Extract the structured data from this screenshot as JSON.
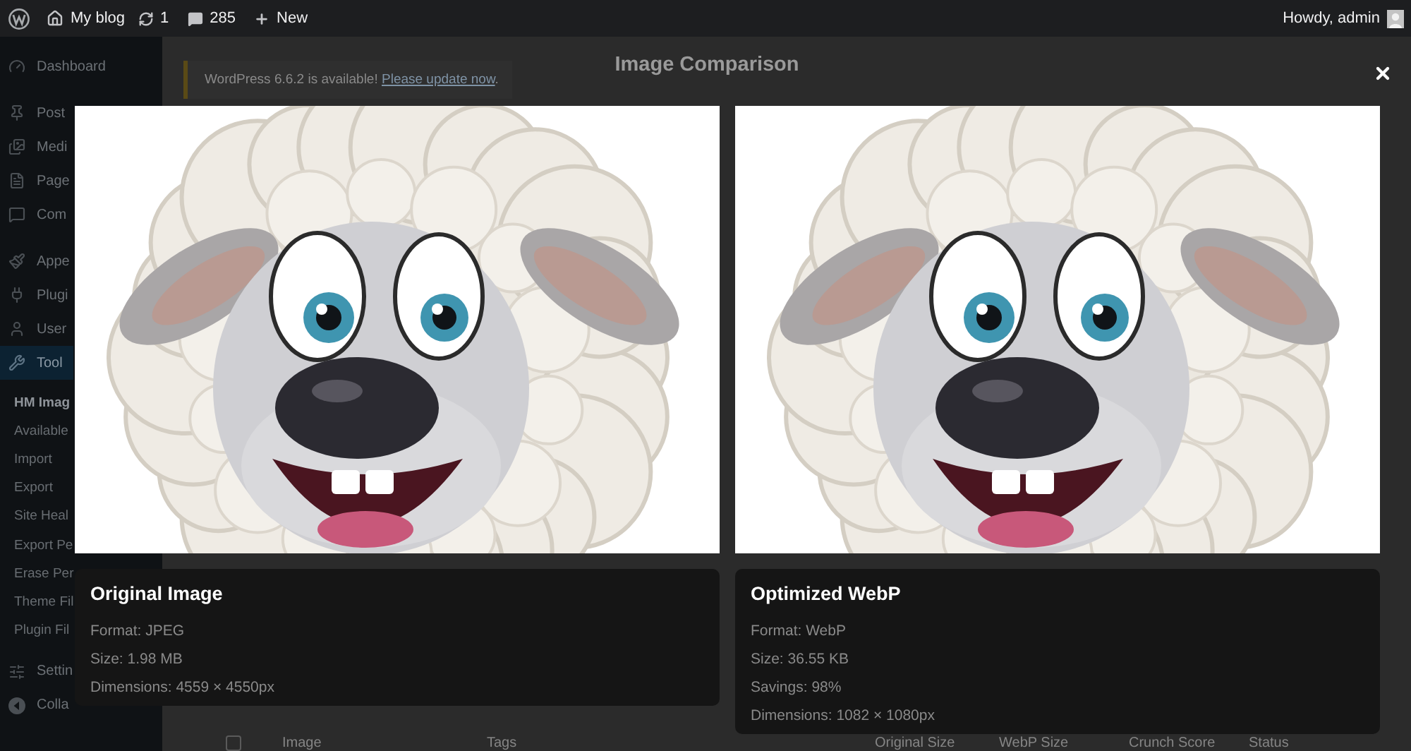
{
  "admin_bar": {
    "site_name": "My blog",
    "updates": "1",
    "comments": "285",
    "new_label": "New",
    "greeting": "Howdy, admin"
  },
  "sidebar": {
    "groups": [
      {
        "items": [
          {
            "label": "Dashboard",
            "selected": false
          }
        ]
      },
      {
        "items": [
          {
            "label": "Post",
            "selected": false
          },
          {
            "label": "Medi",
            "selected": false
          },
          {
            "label": "Page",
            "selected": false
          },
          {
            "label": "Com",
            "selected": false
          }
        ]
      },
      {
        "items": [
          {
            "label": "Appe",
            "selected": false
          },
          {
            "label": "Plugi",
            "selected": false
          },
          {
            "label": "User",
            "selected": false
          },
          {
            "label": "Tool",
            "selected": true,
            "children": [
              {
                "label": "HM Imag",
                "selected": true
              },
              {
                "label": "Available",
                "selected": false
              },
              {
                "label": "Import",
                "selected": false
              },
              {
                "label": "Export",
                "selected": false
              },
              {
                "label": "Site Heal",
                "selected": false
              },
              {
                "label": "Export Pe",
                "selected": false
              },
              {
                "label": "Erase Per",
                "selected": false
              },
              {
                "label": "Theme Fil",
                "selected": false
              },
              {
                "label": "Plugin Fil",
                "selected": false
              }
            ]
          },
          {
            "label": "Settin",
            "selected": false
          },
          {
            "label": "Colla",
            "selected": false
          }
        ]
      }
    ]
  },
  "notice": {
    "message": "WordPress 6.6.2 is available!",
    "link": "Please update now",
    "suffix": "."
  },
  "table": {
    "select_all": {
      "checked": false
    },
    "columns": [
      "Image",
      "Tags",
      "Original Size",
      "WebP Size",
      "Crunch Score",
      "Status"
    ]
  },
  "modal": {
    "title": "Image Comparison",
    "panels": [
      {
        "title": "Original Image",
        "details": [
          "Format: JPEG",
          "Size: 1.98 MB",
          "Dimensions: 4559 × 4550px"
        ]
      },
      {
        "title": "Optimized WebP",
        "details": [
          "Format: WebP",
          "Size: 36.55 KB",
          "Savings: 98%",
          "Dimensions: 1082 × 1080px"
        ]
      }
    ]
  }
}
